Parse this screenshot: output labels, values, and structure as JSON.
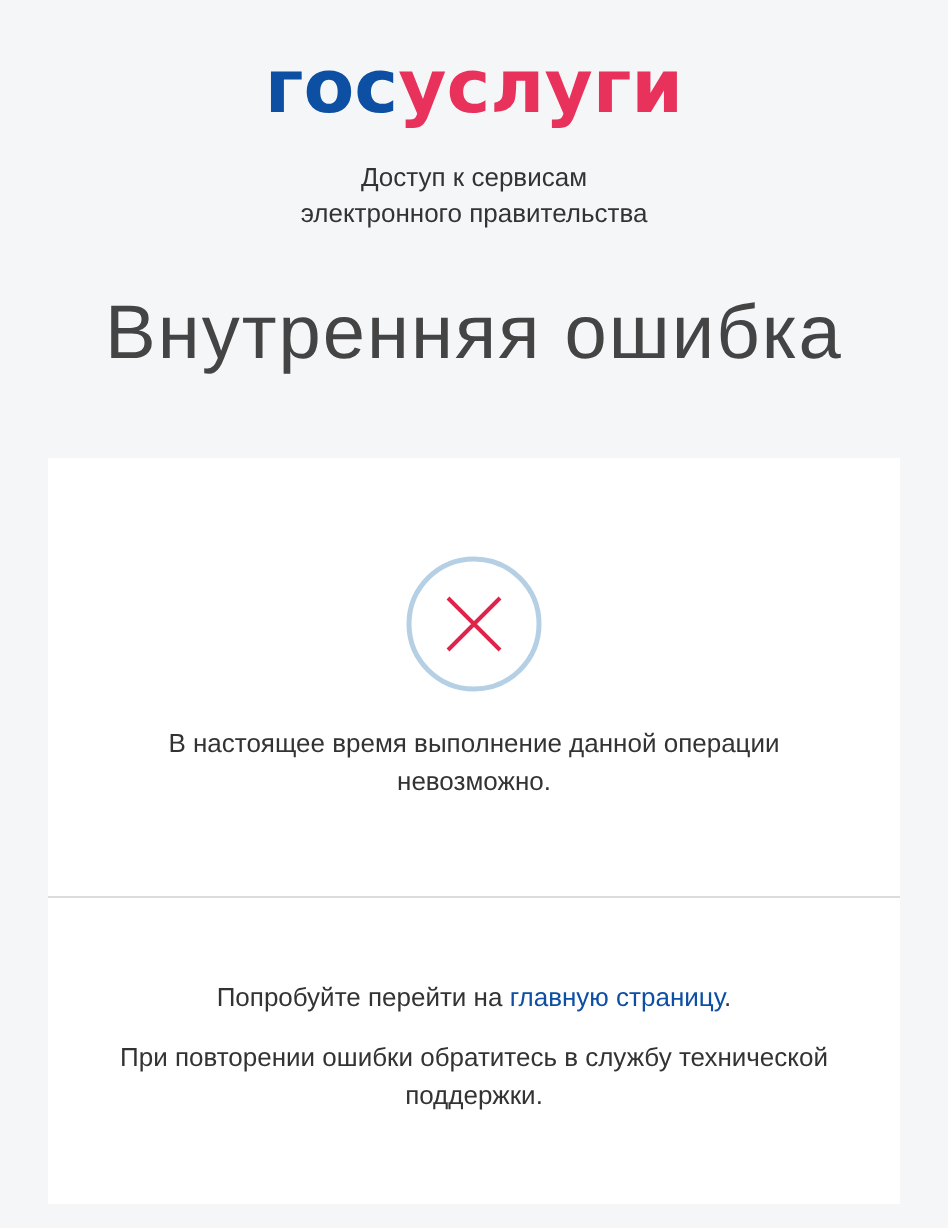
{
  "logo": {
    "first": "гос",
    "second": "услуги"
  },
  "tagline": [
    "Доступ к сервисам",
    "электронного правительства"
  ],
  "title": "Внутренняя ошибка",
  "error_message": "В настоящее время выполнение данной операции невозможно.",
  "hint": {
    "before": "Попробуйте перейти на ",
    "link": "главную страницу",
    "after": "."
  },
  "support_note": "При повторении ошибки обратитесь в службу технической поддержки."
}
